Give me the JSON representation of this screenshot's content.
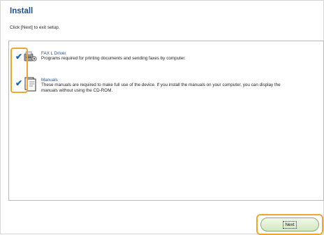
{
  "page": {
    "title": "Install",
    "instruction": "Click [Next] to exit setup."
  },
  "items": [
    {
      "name": "FAX L Driver",
      "description": "Programs required for printing documents and sending faxes by computer.",
      "checked": true,
      "icon": "printer-driver-icon"
    },
    {
      "name": "Manuals",
      "description_line1": "These manuals are required to make full use of the device. If you install the manuals on your computer, you can display the",
      "description_line2": "manuals without using the CD-ROM.",
      "checked": true,
      "icon": "manual-book-icon"
    }
  ],
  "buttons": {
    "next_label": "Next"
  },
  "colors": {
    "title": "#1d4f91",
    "check": "#1d63b8",
    "highlight": "#f1a531",
    "button_green": "#cfe8bd"
  }
}
